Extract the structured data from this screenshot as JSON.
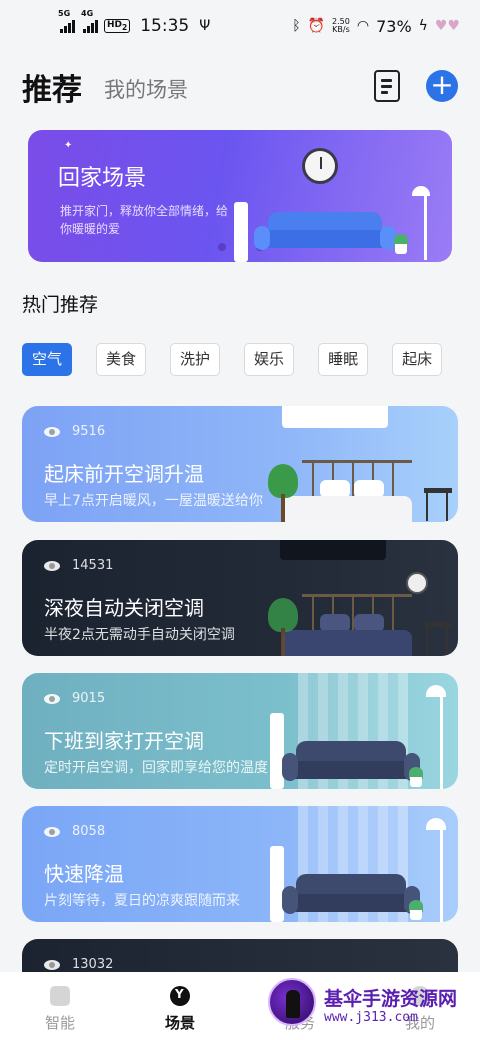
{
  "status_bar": {
    "net1": "5G",
    "net2": "4G",
    "hd": "HD",
    "hd_sub": "2",
    "time": "15:35",
    "speed_value": "2.50",
    "speed_unit": "KB/s",
    "battery": "73%"
  },
  "header": {
    "tab_recommend": "推荐",
    "tab_my_scenes": "我的场景"
  },
  "banner": {
    "title": "回家场景",
    "subtitle": "推开家门，释放你全部情绪，给你暖暖的爱"
  },
  "section": {
    "title": "热门推荐"
  },
  "chips": [
    "空气",
    "美食",
    "洗护",
    "娱乐",
    "睡眠",
    "起床"
  ],
  "cards": [
    {
      "views": "9516",
      "title": "起床前开空调升温",
      "desc": "早上7点开启暖风，一屋温暖送给你"
    },
    {
      "views": "14531",
      "title": "深夜自动关闭空调",
      "desc": "半夜2点无需动手自动关闭空调"
    },
    {
      "views": "9015",
      "title": "下班到家打开空调",
      "desc": "定时开启空调，回家即享给您的温度"
    },
    {
      "views": "8058",
      "title": "快速降温",
      "desc": "片刻等待，夏日的凉爽跟随而来"
    },
    {
      "views": "13032"
    }
  ],
  "bottom_nav": {
    "smart": "智能",
    "scene": "场景",
    "service": "服务",
    "me": "我的"
  },
  "watermark": {
    "title": "基伞手游资源网",
    "url": "www.j313.com"
  },
  "colors": {
    "accent": "#2d73e8",
    "banner_start": "#7b4ce8"
  }
}
